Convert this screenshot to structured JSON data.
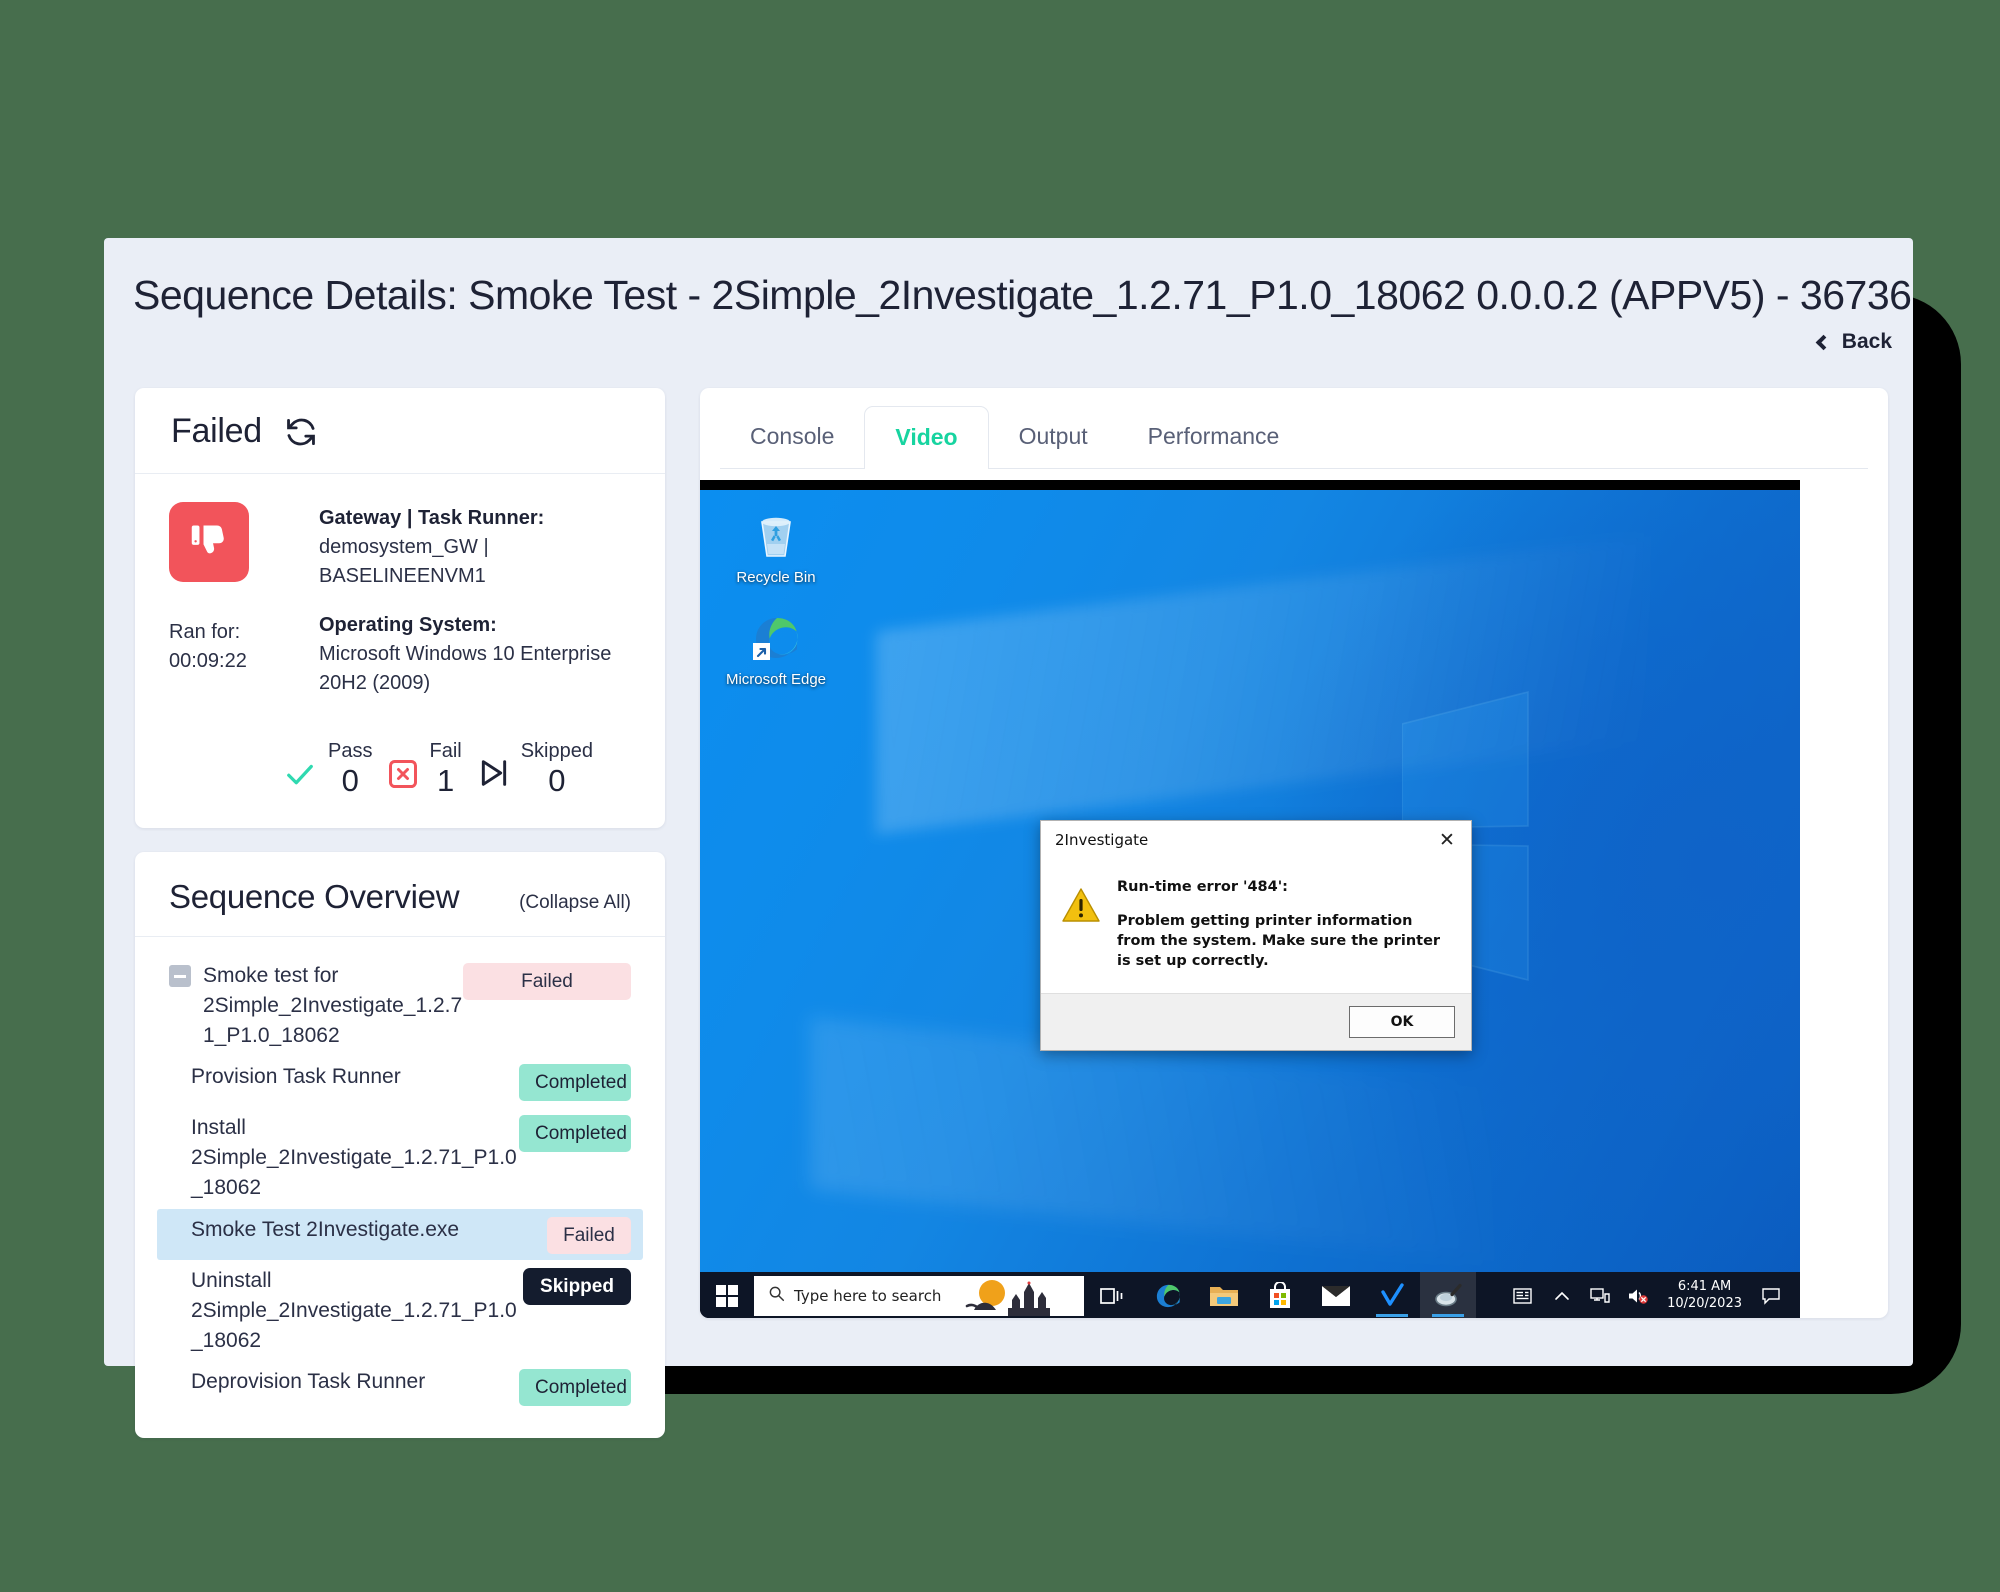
{
  "header": {
    "title": "Sequence Details: Smoke Test - 2Simple_2Investigate_1.2.71_P1.0_18062 0.0.0.2 (APPV5) - 36736",
    "back_label": "Back"
  },
  "status_panel": {
    "status": "Failed",
    "refresh_icon": "refresh-icon",
    "result_icon": "thumbs-down-icon",
    "ran_for_label": "Ran for:",
    "ran_for_value": "00:09:22",
    "gateway_label": "Gateway | Task Runner:",
    "gateway_value": "demosystem_GW | BASELINEENVM1",
    "os_label": "Operating System:",
    "os_value": "Microsoft Windows 10 Enterprise 20H2 (2009)",
    "stats": [
      {
        "caption": "Pass",
        "value": "0",
        "icon": "check-icon"
      },
      {
        "caption": "Fail",
        "value": "1",
        "icon": "x-box-icon"
      },
      {
        "caption": "Skipped",
        "value": "0",
        "icon": "skip-forward-icon"
      }
    ]
  },
  "overview": {
    "title": "Sequence Overview",
    "collapse_label": "(Collapse All)",
    "rows": [
      {
        "label": "Smoke test for 2Simple_2Investigate_1.2.71_P1.0_18062",
        "status": "Failed",
        "kind": "failed",
        "root": true,
        "selected": false
      },
      {
        "label": "Provision Task Runner",
        "status": "Completed",
        "kind": "completed",
        "root": false,
        "selected": false
      },
      {
        "label": "Install 2Simple_2Investigate_1.2.71_P1.0_18062",
        "status": "Completed",
        "kind": "completed",
        "root": false,
        "selected": false
      },
      {
        "label": "Smoke Test 2Investigate.exe",
        "status": "Failed",
        "kind": "failed-small",
        "root": false,
        "selected": true
      },
      {
        "label": "Uninstall 2Simple_2Investigate_1.2.71_P1.0_18062",
        "status": "Skipped",
        "kind": "skipped",
        "root": false,
        "selected": false
      },
      {
        "label": "Deprovision Task Runner",
        "status": "Completed",
        "kind": "completed",
        "root": false,
        "selected": false
      }
    ]
  },
  "tabs": [
    {
      "label": "Console",
      "active": false
    },
    {
      "label": "Video",
      "active": true
    },
    {
      "label": "Output",
      "active": false
    },
    {
      "label": "Performance",
      "active": false
    }
  ],
  "video": {
    "desktop_icons": [
      {
        "label": "Recycle Bin",
        "icon": "recycle-bin-icon"
      },
      {
        "label": "Microsoft Edge",
        "icon": "microsoft-edge-icon"
      }
    ],
    "dialog": {
      "title": "2Investigate",
      "close_icon": "close-icon",
      "warning_icon": "warning-triangle-icon",
      "line1": "Run-time error '484':",
      "line2": "Problem getting printer information from the system. Make sure the printer is set up correctly.",
      "ok_label": "OK"
    },
    "taskbar": {
      "start_icon": "windows-start-icon",
      "search_placeholder": "Type here to search",
      "search_icon": "search-icon",
      "icons": [
        {
          "name": "task-view-icon",
          "active": false,
          "underline": false
        },
        {
          "name": "microsoft-edge-icon",
          "active": false,
          "underline": false
        },
        {
          "name": "file-explorer-icon",
          "active": false,
          "underline": false
        },
        {
          "name": "microsoft-store-icon",
          "active": false,
          "underline": false
        },
        {
          "name": "mail-icon",
          "active": false,
          "underline": false
        },
        {
          "name": "checkmark-app-icon",
          "active": false,
          "underline": true
        },
        {
          "name": "2investigate-app-icon",
          "active": true,
          "underline": true
        }
      ],
      "tray": [
        {
          "name": "news-and-interests-icon"
        },
        {
          "name": "show-hidden-icons-chevron"
        },
        {
          "name": "network-icon"
        },
        {
          "name": "volume-muted-icon"
        }
      ],
      "time": "6:41 AM",
      "date": "10/20/2023",
      "action_center_icon": "action-center-icon"
    }
  },
  "colors": {
    "accent_green": "#17d4a0",
    "fail_red": "#f2545b",
    "pill_failed_bg": "#fbe0e3",
    "pill_completed_bg": "#95e6d1",
    "pill_skipped_bg": "#141c2e",
    "selected_row": "#cfe7f7",
    "page_bg": "#eaeef6"
  }
}
